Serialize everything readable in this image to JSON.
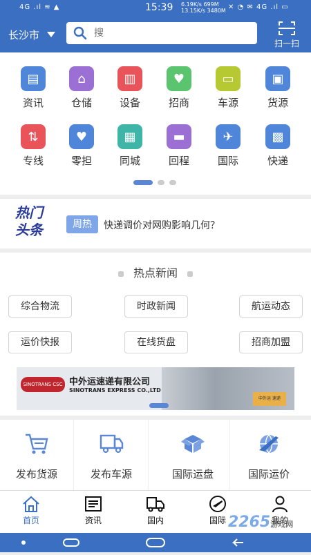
{
  "status_bar": {
    "left": "4G .ıl  ≋  ▲",
    "time": "15:39",
    "speed_top": "6.19K/s  699M",
    "speed_bottom": "13.15K/s 3480M",
    "right": "✕ ◔ ✉ 4G .ıl ▭"
  },
  "header": {
    "city": "长沙市",
    "search_placeholder": "搜",
    "scan_label": "扫一扫"
  },
  "grid": {
    "items": [
      {
        "label": "资讯",
        "icon": "news-icon",
        "color": "#4f86d9"
      },
      {
        "label": "仓储",
        "icon": "warehouse-icon",
        "color": "#9b6fd4"
      },
      {
        "label": "设备",
        "icon": "equipment-icon",
        "color": "#e8545a"
      },
      {
        "label": "招商",
        "icon": "handshake-icon",
        "color": "#5bc46f"
      },
      {
        "label": "车源",
        "icon": "car-icon",
        "color": "#b6c832"
      },
      {
        "label": "货源",
        "icon": "package-icon",
        "color": "#4f86d9"
      },
      {
        "label": "专线",
        "icon": "route-icon",
        "color": "#e8545a"
      },
      {
        "label": "零担",
        "icon": "heart-box-icon",
        "color": "#4f86d9"
      },
      {
        "label": "同城",
        "icon": "city-icon",
        "color": "#3fb5a8"
      },
      {
        "label": "回程",
        "icon": "return-truck-icon",
        "color": "#9b6fd4"
      },
      {
        "label": "国际",
        "icon": "airplane-icon",
        "color": "#4f86d9"
      },
      {
        "label": "快递",
        "icon": "courier-icon",
        "color": "#4f86d9"
      }
    ],
    "page_count": 3,
    "active_page": 1
  },
  "hot": {
    "logo_line1": "热门",
    "logo_line2": "头条",
    "tag": "周热",
    "headline": "快递调价对网购影响几何？"
  },
  "news": {
    "title": "热点新闻",
    "categories": [
      "综合物流",
      "时政新闻",
      "航运动态",
      "运价快报",
      "在线货盘",
      "招商加盟"
    ],
    "banner": {
      "company_cn": "中外运速递有限公司",
      "company_en": "SINOTRANS EXPRESS CO.,LTD",
      "left_logo": "SINOTRANS CSC",
      "box_text": "中外运 速递"
    }
  },
  "publish": {
    "items": [
      {
        "label": "发布货源",
        "icon": "cart-icon"
      },
      {
        "label": "发布车源",
        "icon": "truck-icon"
      },
      {
        "label": "国际运盘",
        "icon": "box-open-icon"
      },
      {
        "label": "国际运价",
        "icon": "globe-plane-icon"
      }
    ]
  },
  "tabs": {
    "items": [
      {
        "label": "首页",
        "icon": "home-icon",
        "active": true
      },
      {
        "label": "资讯",
        "icon": "newspaper-icon",
        "active": false
      },
      {
        "label": "国内",
        "icon": "truck-icon",
        "active": false
      },
      {
        "label": "国际",
        "icon": "plane-circle-icon",
        "active": false
      },
      {
        "label": "我的",
        "icon": "user-icon",
        "active": false
      }
    ]
  },
  "watermark": {
    "text": "2265",
    "sub": "游戏网"
  },
  "colors": {
    "brand": "#3a6fc2",
    "active_dot": "#5a86d6"
  }
}
